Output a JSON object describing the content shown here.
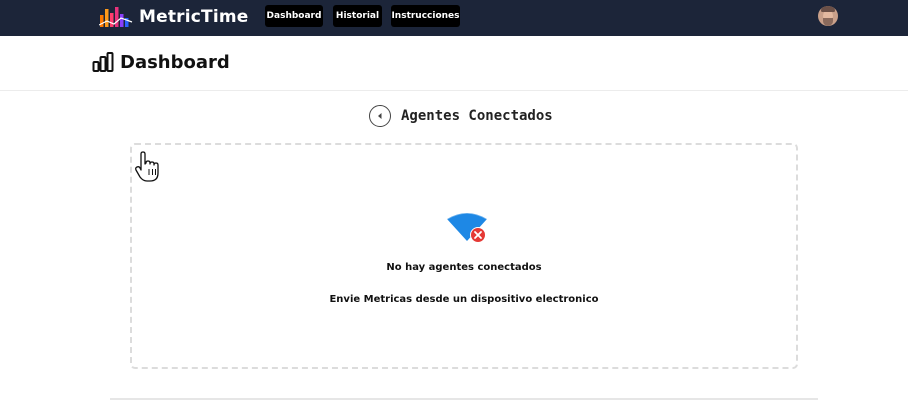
{
  "app": {
    "name": "MetricTime",
    "logo_colors": [
      "#ff7a00",
      "#ff3d6e",
      "#8a3ffc",
      "#2962ff"
    ]
  },
  "nav": {
    "items": [
      {
        "label": "Dashboard"
      },
      {
        "label": "Historial"
      },
      {
        "label": "Instrucciones"
      }
    ]
  },
  "user": {
    "avatar_icon": "user-avatar"
  },
  "page": {
    "title": "Dashboard",
    "title_icon": "bar-chart-icon"
  },
  "agents": {
    "section_title": "Agentes Conectados",
    "back_icon": "arrow-left-circle-icon",
    "empty_icon": "wifi-off-icon",
    "empty_title": "No hay agentes conectados",
    "empty_subtitle": "Envie Metricas desde un dispositivo electronico"
  },
  "colors": {
    "topbar": "#1c2539",
    "nav_button": "#000000",
    "wifi_blue": "#1e88e5",
    "error_red": "#e53935"
  }
}
